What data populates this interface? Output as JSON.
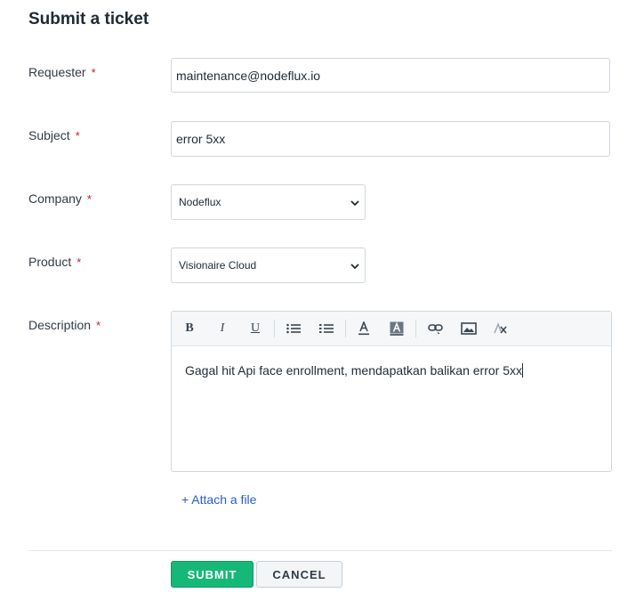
{
  "form": {
    "title": "Submit a ticket",
    "required_marker": "*",
    "requester": {
      "label": "Requester",
      "value": "maintenance@nodeflux.io"
    },
    "subject": {
      "label": "Subject",
      "value": "error 5xx"
    },
    "company": {
      "label": "Company",
      "selected": "Nodeflux"
    },
    "product": {
      "label": "Product",
      "selected": "Visionaire Cloud"
    },
    "description": {
      "label": "Description",
      "value": "Gagal hit Api face enrollment, mendapatkan balikan error 5xx",
      "toolbar": {
        "bold": "B",
        "italic": "I",
        "underline": "U"
      }
    },
    "attach_label": "+ Attach a file",
    "submit_label": "SUBMIT",
    "cancel_label": "CANCEL"
  },
  "colors": {
    "submit_bg": "#16b877",
    "link": "#2c5cc5",
    "required": "#c81e1e"
  }
}
